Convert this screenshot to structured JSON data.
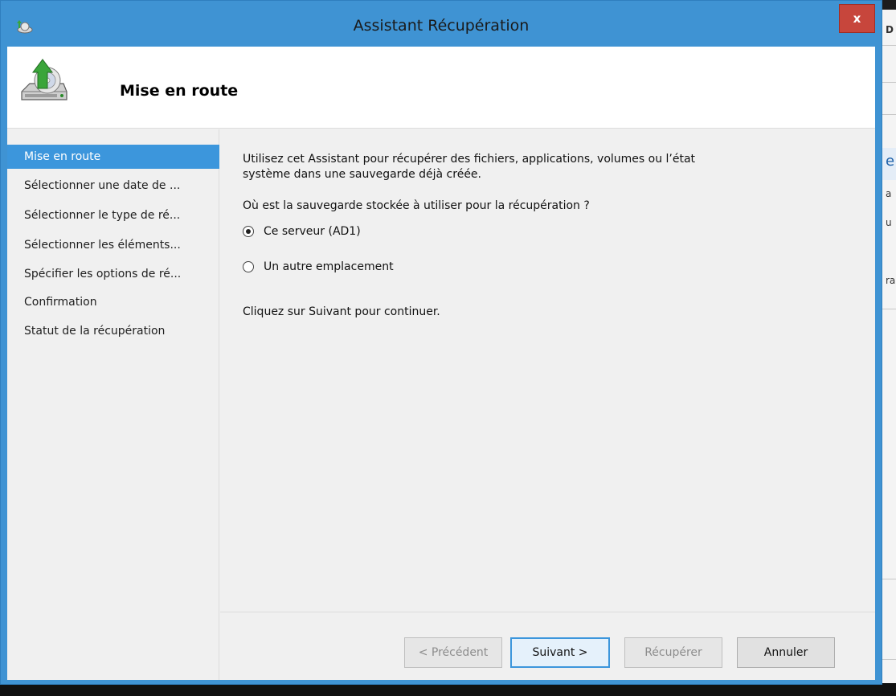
{
  "window": {
    "title": "Assistant Récupération",
    "close_label": "x",
    "header_title": "Mise en route"
  },
  "sidebar": {
    "items": [
      {
        "label": "Mise en route",
        "active": true
      },
      {
        "label": "Sélectionner une date de ..."
      },
      {
        "label": "Sélectionner le type de ré..."
      },
      {
        "label": "Sélectionner les éléments..."
      },
      {
        "label": "Spécifier les options de ré..."
      },
      {
        "label": "Confirmation"
      },
      {
        "label": "Statut de la récupération"
      }
    ]
  },
  "content": {
    "intro": "Utilisez cet Assistant pour récupérer des fichiers, applications, volumes ou l’état système dans une sauvegarde déjà créée.",
    "question": "Où est la sauvegarde stockée à utiliser pour la récupération ?",
    "options": [
      {
        "label": "Ce serveur (AD1)",
        "checked": true
      },
      {
        "label": "Un autre emplacement",
        "checked": false
      }
    ],
    "continue_text": "Cliquez sur Suivant pour continuer."
  },
  "buttons": {
    "previous": "< Précédent",
    "next": "Suivant >",
    "recover": "Récupérer",
    "cancel": "Annuler"
  },
  "colors": {
    "titlebar": "#3f93d3",
    "accent": "#3c96dc",
    "close": "#c7463c"
  },
  "background_window": {
    "fragments": [
      "D",
      "e",
      "a",
      "u",
      "ra"
    ]
  }
}
